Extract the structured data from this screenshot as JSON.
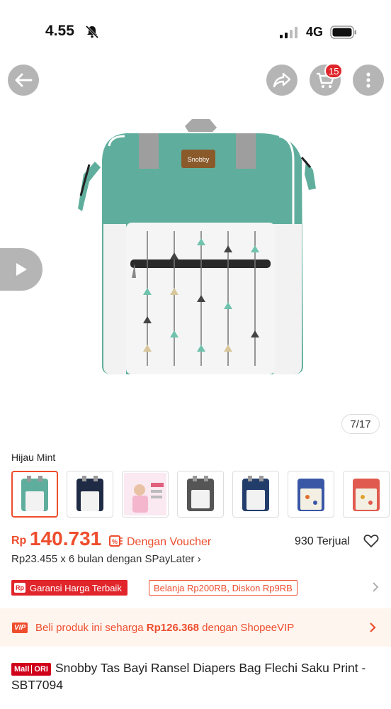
{
  "status": {
    "time": "4.55",
    "network": "4G"
  },
  "header": {
    "cart_count": "15",
    "icons": [
      "back-arrow-icon",
      "share-icon",
      "cart-icon",
      "more-vertical-icon"
    ]
  },
  "gallery": {
    "counter": "7/17"
  },
  "variant": {
    "label": "Hijau Mint",
    "selected_index": 0,
    "options_count": 7
  },
  "price": {
    "currency": "Rp",
    "amount": "140.731",
    "voucher_text": "Dengan Voucher",
    "sold": "930 Terjual"
  },
  "paylater": {
    "text": "Rp23.455 x 6 bulan dengan SPayLater",
    "chevron": "›"
  },
  "guarantee": {
    "icon_text": "Rp",
    "label": "Garansi Harga Terbaik",
    "promo": "Belanja Rp200RB, Diskon Rp9RB"
  },
  "vip": {
    "tag": "VIP",
    "prefix": "Beli produk ini seharga ",
    "price": "Rp126.368",
    "suffix": " dengan ShopeeVIP"
  },
  "product": {
    "badge_mall": "Mall",
    "badge_ori": "ORI",
    "title": "Snobby Tas Bayi Ransel Diapers Bag Flechi Saku Print - SBT7094"
  },
  "colors": {
    "accent": "#ee4d2d",
    "bag_teal": "#5fae9d"
  }
}
